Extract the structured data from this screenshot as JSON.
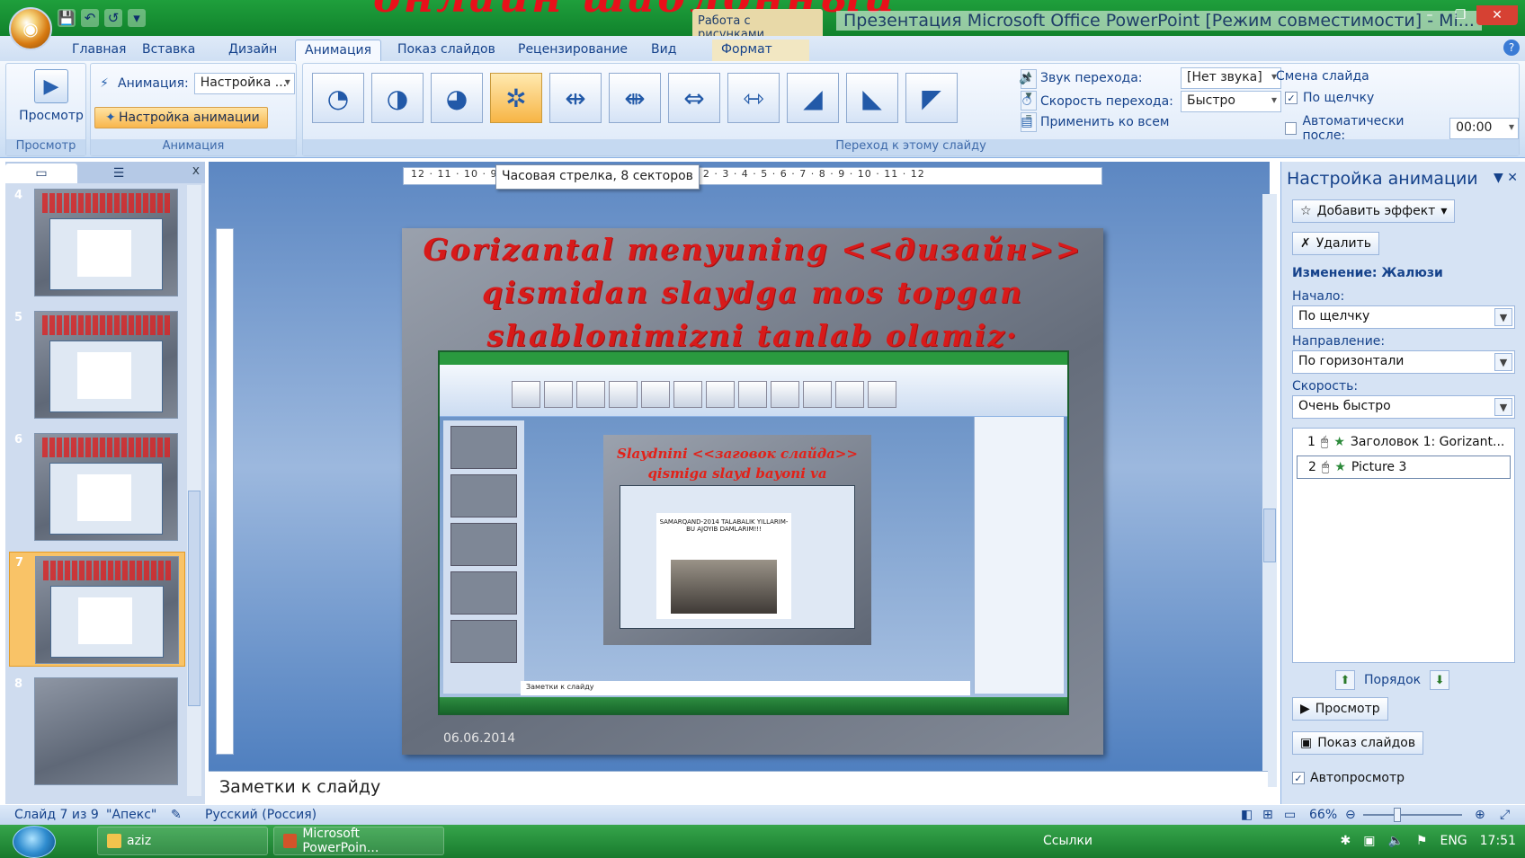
{
  "window": {
    "overlay_heading": "онлайн шаблонный",
    "context_tool_group": "Работа с рисунками",
    "title": "Презентация Microsoft Office PowerPoint [Режим совместимости] - Mi...",
    "office_button_glyph": "◉",
    "qat": {
      "save": "💾",
      "undo": "↶",
      "redo": "↺",
      "more": "▾"
    },
    "controls": {
      "minimize": "–",
      "restore": "❐",
      "close": "✕"
    }
  },
  "tabs": [
    "Главная",
    "Вставка",
    "Дизайн",
    "Анимация",
    "Показ слайдов",
    "Рецензирование",
    "Вид",
    "Формат"
  ],
  "active_tab": "Анимация",
  "ribbon": {
    "preview": {
      "label": "Просмотр",
      "group": "Просмотр"
    },
    "animation": {
      "label": "Анимация:",
      "value": "Настройка ...",
      "custom_button": "Настройка анимации",
      "group": "Анимация"
    },
    "transition": {
      "group": "Переход к этому слайду",
      "gallery_glyphs": [
        "◔",
        "◑",
        "◕",
        "✲",
        "⇹",
        "⇼",
        "⇔",
        "⇿",
        "◢",
        "◣",
        "◤"
      ],
      "selected_index": 3,
      "sound_label": "Звук перехода:",
      "sound_value": "[Нет звука]",
      "speed_label": "Скорость перехода:",
      "speed_value": "Быстро",
      "apply_all": "Применить ко всем"
    },
    "advance": {
      "label": "Смена слайда",
      "on_click": "По щелчку",
      "on_click_checked": true,
      "auto_after": "Автоматически после:",
      "auto_value": "00:00"
    }
  },
  "ruler_text": "12 · 11 · 10 · 9 · 8 · 7 · 6 · 5 · 4 · 3 · 2 · 1 · 0 · 1 · 2 · 3 · 4 · 5 · 6 · 7 · 8 · 9 · 10 · 11 · 12",
  "tooltip": "Часовая стрелка, 8 секторов",
  "slides_pane": {
    "thumbnails": [
      {
        "num": "4",
        "selected": false
      },
      {
        "num": "5",
        "selected": false
      },
      {
        "num": "6",
        "selected": false
      },
      {
        "num": "7",
        "selected": true
      },
      {
        "num": "8",
        "selected": false
      }
    ],
    "close": "x"
  },
  "slide": {
    "title_lines": [
      "Gorizantal menyuning <<дизайн>>",
      "qismidan slaydga mos topgan",
      "shablonimizni  tanlab olamiz·"
    ],
    "date": "06.06.2014",
    "nested_text": "Slaydnini <<заговок слайда>> qismiga slayd bayoni va <<текст",
    "nested_inner_title": "SAMARQAND-2014 TALABALIK YILLARIM-BU AJOYIB DAMLARIM!!!",
    "nested_notes": "Заметки к слайду"
  },
  "notes": "Заметки к слайду",
  "task_pane": {
    "title": "Настройка анимации",
    "add_effect": "Добавить эффект",
    "remove": "Удалить",
    "change_label": "Изменение: Жалюзи",
    "start_label": "Начало:",
    "start_value": "По щелчку",
    "direction_label": "Направление:",
    "direction_value": "По горизонтали",
    "speed_label": "Скорость:",
    "speed_value": "Очень быстро",
    "items": [
      {
        "num": "1",
        "text": "Заголовок 1: Gorizant..."
      },
      {
        "num": "2",
        "text": "Picture 3"
      }
    ],
    "order_label": "Порядок",
    "play": "Просмотр",
    "slideshow": "Показ слайдов",
    "autopreview": "Автопросмотр",
    "autopreview_checked": true
  },
  "status": {
    "slide_of": "Слайд 7 из 9",
    "theme": "\"Апекс\"",
    "language": "Русский (Россия)",
    "zoom": "66%"
  },
  "taskbar": {
    "items": [
      "aziz",
      "Microsoft PowerPoin..."
    ],
    "links": "Ссылки",
    "lang": "ENG",
    "time": "17:51"
  }
}
